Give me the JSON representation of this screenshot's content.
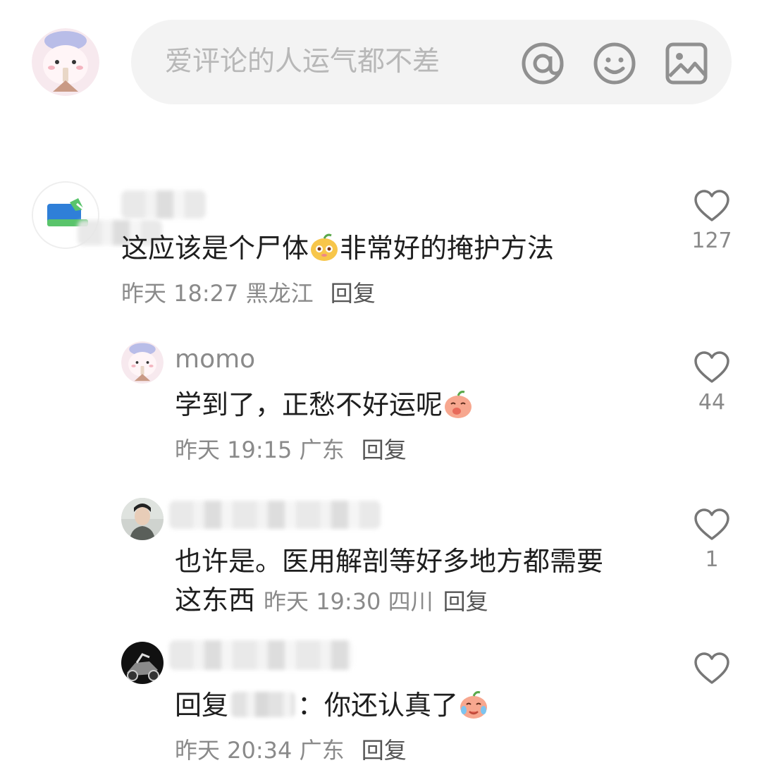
{
  "composer": {
    "placeholder": "爱评论的人运气都不差",
    "icons": [
      "at-icon",
      "emoji-icon",
      "image-icon"
    ]
  },
  "comments": [
    {
      "username": "",
      "text_before_emoji": "这应该是个尸体",
      "text_after_emoji": "非常好的掩护方法",
      "time": "昨天 18:27",
      "location": "黑龙江",
      "reply_label": "回复",
      "likes": "127"
    },
    {
      "username": "momo",
      "text": "学到了，正愁不好运呢",
      "time": "昨天 19:15",
      "location": "广东",
      "reply_label": "回复",
      "likes": "44"
    },
    {
      "username": "",
      "text_line1": "也许是。医用解剖等好多地方都需要",
      "text_line2": "这东西",
      "time": "昨天 19:30",
      "location": "四川",
      "reply_label": "回复",
      "likes": "1"
    },
    {
      "username": "",
      "reply_prefix": "回复",
      "text": "：你还认真了",
      "time": "昨天 20:34",
      "location": "广东",
      "reply_label": "回复",
      "likes": ""
    }
  ],
  "colors": {
    "composer_bg": "#f3f3f3",
    "placeholder": "#b8b8b8",
    "meta": "#8a8a8a",
    "text": "#1e1e1e"
  }
}
